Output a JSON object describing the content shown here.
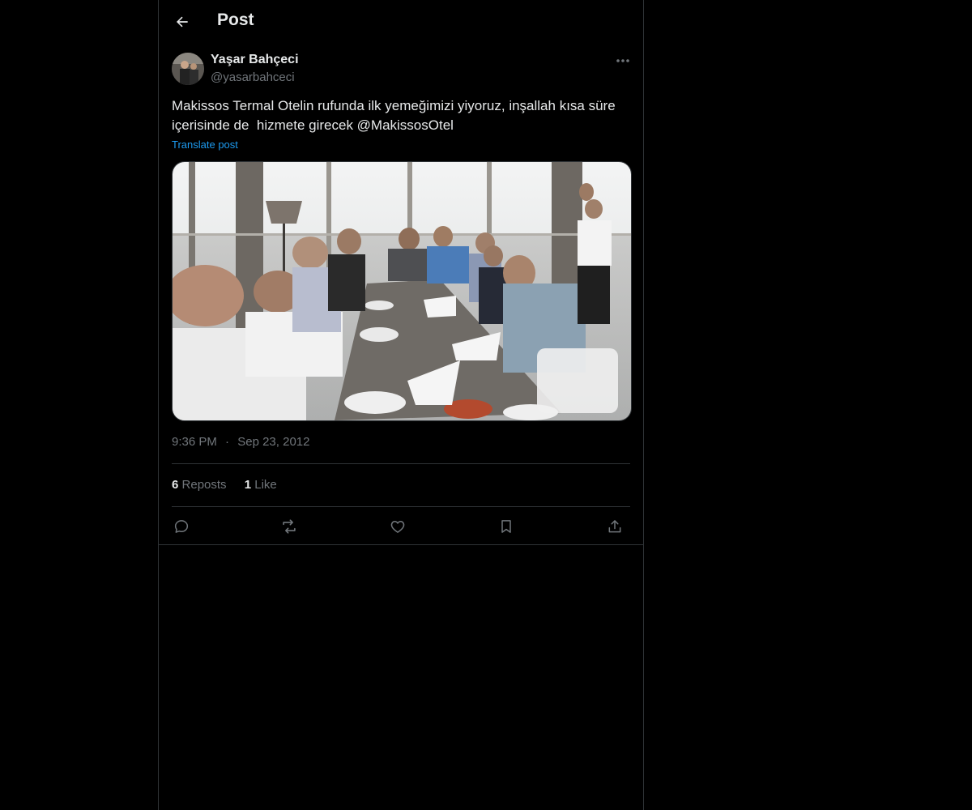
{
  "header": {
    "title": "Post",
    "back_icon": "arrow-left-icon"
  },
  "author": {
    "display_name": "Yaşar Bahçeci",
    "handle": "@yasarbahceci"
  },
  "post": {
    "text": "Makissos Termal Otelin rufunda ilk yemeğimizi yiyoruz, inşallah kısa süre içerisinde de  hizmete girecek @MakissosOtel",
    "translate_label": "Translate post",
    "time": "9:36 PM",
    "separator": "·",
    "date": "Sep 23, 2012"
  },
  "stats": {
    "reposts_count": "6",
    "reposts_label": "Reposts",
    "likes_count": "1",
    "likes_label": "Like"
  },
  "actions": [
    "reply-icon",
    "repost-icon",
    "like-icon",
    "bookmark-icon",
    "share-icon"
  ],
  "colors": {
    "background": "#000000",
    "text": "#e7e9ea",
    "secondary": "#71767b",
    "link": "#1d9bf0",
    "border": "#2f3336"
  }
}
